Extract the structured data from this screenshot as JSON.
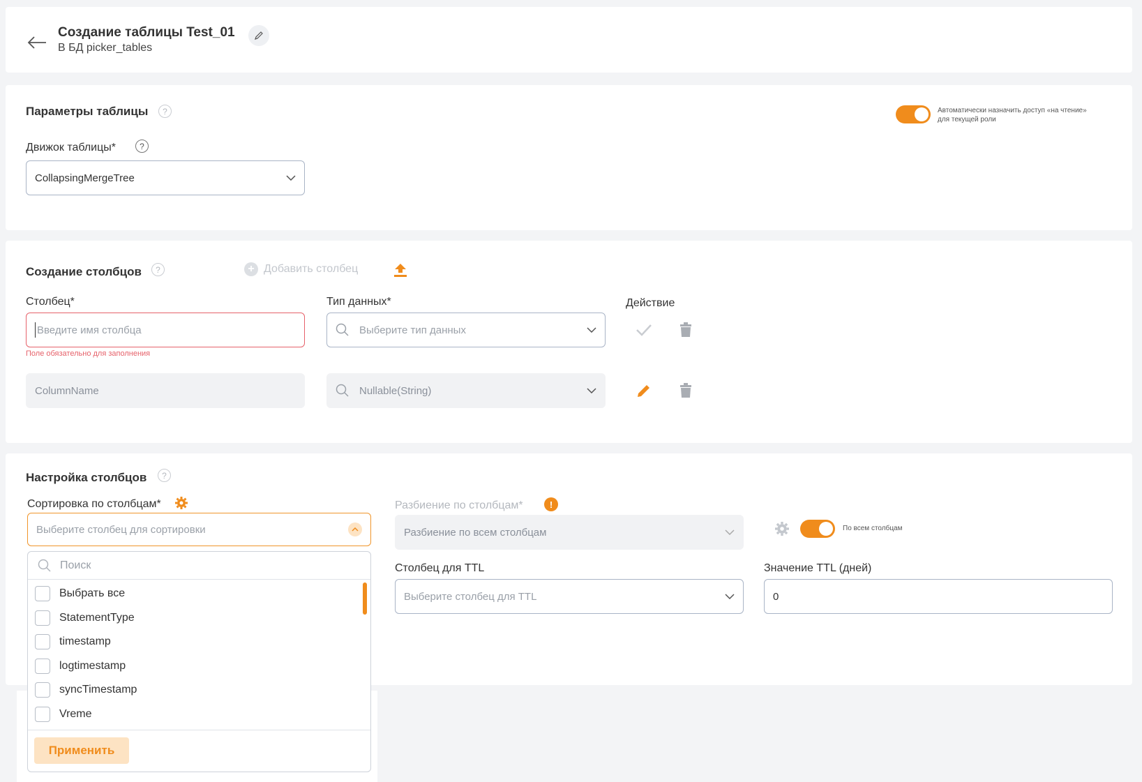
{
  "header": {
    "title": "Создание таблицы Test_01",
    "subtitle": "В БД picker_tables"
  },
  "params": {
    "section_title": "Параметры таблицы",
    "engine_label": "Движок таблицы*",
    "engine_value": "CollapsingMergeTree",
    "auto_access_line1": "Автоматически назначить доступ «на чтение»",
    "auto_access_line2": "для текущей роли",
    "auto_access_on": true
  },
  "columns": {
    "section_title": "Создание столбцов",
    "add_column_label": "Добавить столбец",
    "column_label": "Столбец*",
    "type_label": "Тип данных*",
    "action_label": "Действие",
    "new_row": {
      "name_placeholder": "Введите имя столбца",
      "type_placeholder": "Выберите тип данных",
      "error": "Поле обязательно для заполнения"
    },
    "rows": [
      {
        "name": "ColumnName",
        "type": "Nullable(String)"
      }
    ]
  },
  "settings": {
    "section_title": "Настройка столбцов",
    "sort_label": "Сортировка по столбцам*",
    "sort_placeholder": "Выберите столбец для сортировки",
    "partition_label": "Разбиение по столбцам*",
    "partition_value": "Разбиение по всем столбцам",
    "all_columns_label": "По всем столбцам",
    "all_columns_on": true,
    "ttl_column_label": "Столбец для TTL",
    "ttl_column_placeholder": "Выберите столбец для TTL",
    "ttl_value_label": "Значение TTL (дней)",
    "ttl_value": "0"
  },
  "dropdown": {
    "search_placeholder": "Поиск",
    "items": [
      "Выбрать все",
      "StatementType",
      "timestamp",
      "logtimestamp",
      "syncTimestamp",
      "Vreme"
    ],
    "apply_label": "Применить"
  },
  "colors": {
    "accent": "#f08c1c",
    "error": "#e6616a",
    "background": "#f3f4f6"
  }
}
